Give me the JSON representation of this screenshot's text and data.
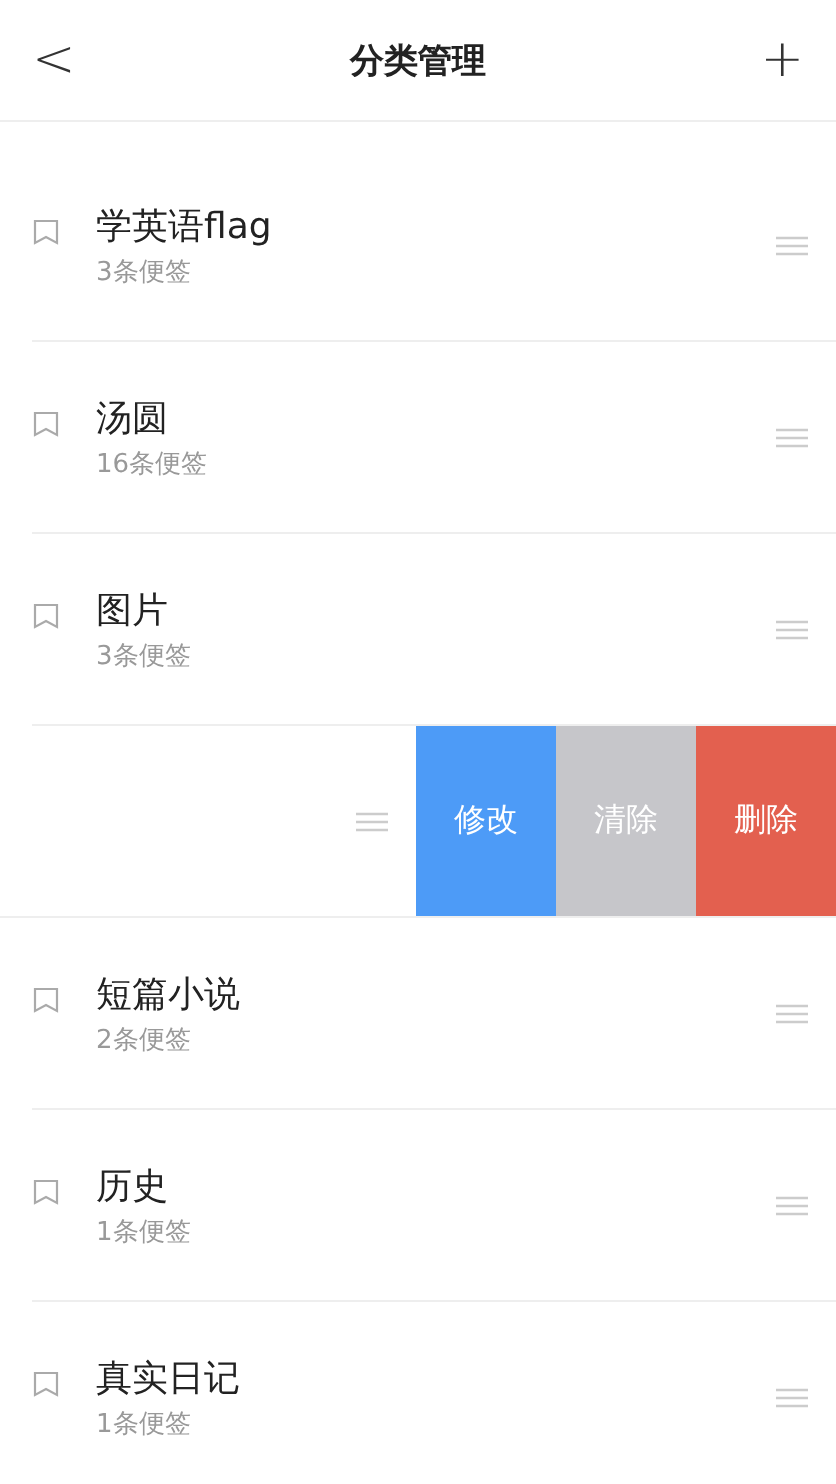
{
  "header": {
    "back": "<",
    "title": "分类管理",
    "add": "+"
  },
  "rows": [
    {
      "kind": "category",
      "name": "学英语flag",
      "count": "3条便签"
    },
    {
      "kind": "category",
      "name": "汤圆",
      "count": "16条便签"
    },
    {
      "kind": "category",
      "name": "图片",
      "count": "3条便签"
    },
    {
      "kind": "swiped",
      "actions": [
        {
          "label": "修改",
          "color": "#4d9bf7"
        },
        {
          "label": "清除",
          "color": "#c6c6ca"
        },
        {
          "label": "删除",
          "color": "#e3604f"
        }
      ]
    },
    {
      "kind": "category",
      "name": "短篇小说",
      "count": "2条便签"
    },
    {
      "kind": "category",
      "name": "历史",
      "count": "1条便签"
    },
    {
      "kind": "category",
      "name": "真实日记",
      "count": "1条便签"
    }
  ]
}
